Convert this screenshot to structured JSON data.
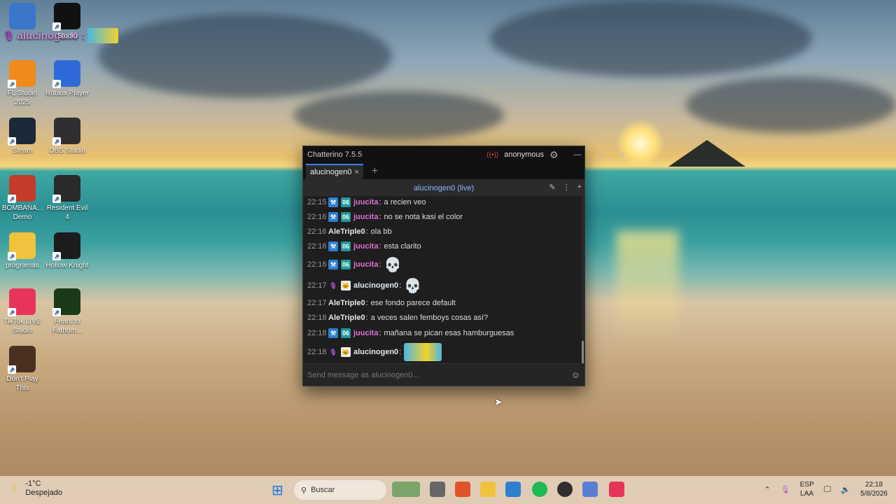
{
  "desktop": {
    "overlay": {
      "username": "alucinogen0",
      "separator": ":"
    },
    "icons": [
      {
        "label": "",
        "icon": "recycle-bin-icon",
        "color": "#3b76c8"
      },
      {
        "label": "Studio",
        "icon": "roblox-studio-icon",
        "color": "#111111"
      },
      {
        "label": "FL Studio 2025",
        "icon": "fl-studio-icon",
        "color": "#f08a1a"
      },
      {
        "label": "Roblox Player",
        "icon": "roblox-player-icon",
        "color": "#2f6bd8"
      },
      {
        "label": "Steam",
        "icon": "steam-icon",
        "color": "#1b2838"
      },
      {
        "label": "OBS Studio",
        "icon": "obs-icon",
        "color": "#302e31"
      },
      {
        "label": "BOMBANA... Demo",
        "icon": "bombana-icon",
        "color": "#c43a2b"
      },
      {
        "label": "Resident Evil 4",
        "icon": "resident-evil-icon",
        "color": "#2a2a2a"
      },
      {
        "label": "programas",
        "icon": "folder-icon",
        "color": "#f1c23b"
      },
      {
        "label": "Hollow Knight",
        "icon": "hollow-knight-icon",
        "color": "#1c1c1c"
      },
      {
        "label": "TikTok LIVE Studio",
        "icon": "tiktok-live-icon",
        "color": "#e8345a"
      },
      {
        "label": "Fears to Fathom...",
        "icon": "fears-to-fathom-icon",
        "color": "#1a3a1a"
      },
      {
        "label": "Don't Play This",
        "icon": "dont-play-this-icon",
        "color": "#4a3020"
      }
    ]
  },
  "chat": {
    "title": "Chatterino 7.5.5",
    "account": "anonymous",
    "tab_label": "alucinogen0",
    "tab_close": "×",
    "add_tab": "+",
    "channel_header": "alucinogen0 (live)",
    "input_placeholder": "Send message as alucinogen0...",
    "colors": {
      "juucita": "#e26fd3",
      "AleTriple0": "#e8e8e8",
      "alucinogen0": "#dfe8f0"
    },
    "messages": [
      {
        "time": "22:15",
        "badges": [
          "mod",
          "sub"
        ],
        "user": "juucita",
        "text": "a recien veo"
      },
      {
        "time": "22:16",
        "badges": [
          "mod",
          "sub"
        ],
        "user": "juucita",
        "text": "no se nota kasi el color"
      },
      {
        "time": "22:16",
        "badges": [],
        "user": "AleTriple0",
        "text": "ola bb"
      },
      {
        "time": "22:16",
        "badges": [
          "mod",
          "sub"
        ],
        "user": "juucita",
        "text": "esta clarito"
      },
      {
        "time": "22:16",
        "badges": [
          "mod",
          "sub"
        ],
        "user": "juucita",
        "text": "",
        "emote": "skull"
      },
      {
        "time": "22:17",
        "badges": [
          "mic",
          "cat"
        ],
        "user": "alucinogen0",
        "text": "",
        "emote": "skull"
      },
      {
        "time": "22:17",
        "badges": [],
        "user": "AleTriple0",
        "text": "ese fondo parece default"
      },
      {
        "time": "22:18",
        "badges": [],
        "user": "AleTriple0",
        "text": "a veces salen femboys cosas así?"
      },
      {
        "time": "22:18",
        "badges": [
          "mod",
          "sub"
        ],
        "user": "juucita",
        "text": "mañana se pican esas hamburguesas"
      },
      {
        "time": "22:18",
        "badges": [
          "mic",
          "cat"
        ],
        "user": "alucinogen0",
        "text": "",
        "emote": "minion"
      }
    ]
  },
  "taskbar": {
    "weather": {
      "temp": "-1°C",
      "condition": "Despejado"
    },
    "search_label": "Buscar",
    "language": {
      "line1": "ESP",
      "line2": "LAA"
    },
    "clock": {
      "time": "22:18",
      "date": "5/8/2026"
    }
  }
}
